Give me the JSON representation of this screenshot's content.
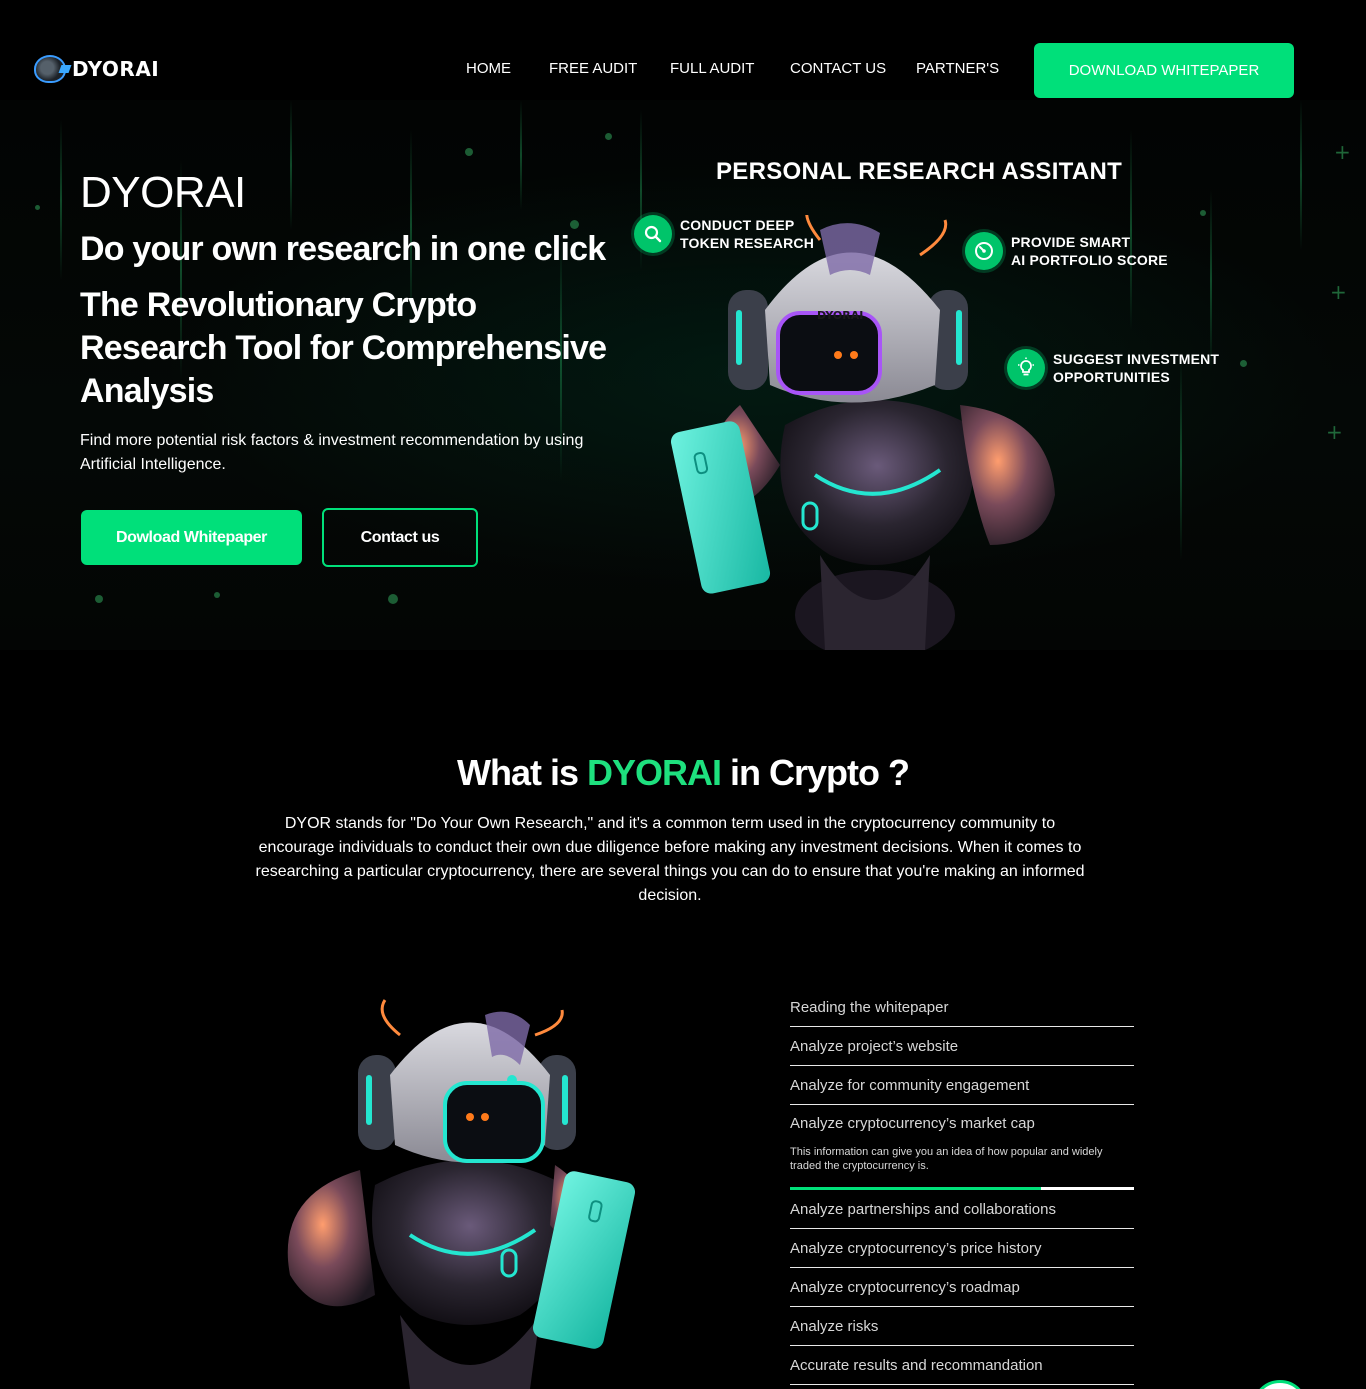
{
  "brand": {
    "name": "DYORAI"
  },
  "nav": {
    "links": [
      "HOME",
      "FREE AUDIT",
      "FULL AUDIT",
      "CONTACT US",
      "PARTNER'S"
    ],
    "cta": "DOWNLOAD WHITEPAPER"
  },
  "hero": {
    "title": "DYORAI",
    "subtitle": "Do your own research in one click",
    "headline": "The Revolutionary Crypto Research Tool for Comprehensive Analysis",
    "description": "Find more potential risk factors & investment recommendation by using Artificial Intelligence.",
    "primary_button": "Dowload Whitepaper",
    "secondary_button": "Contact us"
  },
  "assistant": {
    "title": "PERSONAL RESEARCH ASSITANT",
    "robot_label": "DYORAI",
    "features": [
      {
        "icon": "search-icon",
        "text": "CONDUCT DEEP\nTOKEN RESEARCH"
      },
      {
        "icon": "gauge-icon",
        "text": "PROVIDE SMART\nAI PORTFOLIO SCORE"
      },
      {
        "icon": "lightbulb-icon",
        "text": "SUGGEST INVESTMENT\nOPPORTUNITIES"
      }
    ]
  },
  "about": {
    "title_prefix": "What is ",
    "title_accent": "DYORAI",
    "title_suffix": " in Crypto ?",
    "description": "DYOR stands for \"Do Your Own Research,\" and it's a common term used in the cryptocurrency community to encourage individuals to conduct their own due diligence before making any investment decisions. When it comes to researching a particular cryptocurrency, there are several things you can do to ensure that you're making an informed decision."
  },
  "checklist": {
    "items": [
      {
        "label": "Reading the whitepaper"
      },
      {
        "label": "Analyze project’s website"
      },
      {
        "label": "Analyze for community engagement"
      },
      {
        "label": "Analyze cryptocurrency’s market cap",
        "detail": "This information can give you an idea of how popular and widely traded the cryptocurrency is.",
        "progress": 0.73
      },
      {
        "label": "Analyze partnerships and collaborations"
      },
      {
        "label": "Analyze cryptocurrency’s price history"
      },
      {
        "label": "Analyze cryptocurrency’s roadmap"
      },
      {
        "label": "Analyze risks"
      },
      {
        "label": "Accurate results and recommandation"
      }
    ]
  },
  "colors": {
    "accent": "#00e07a",
    "background": "#000000",
    "text": "#ffffff"
  }
}
